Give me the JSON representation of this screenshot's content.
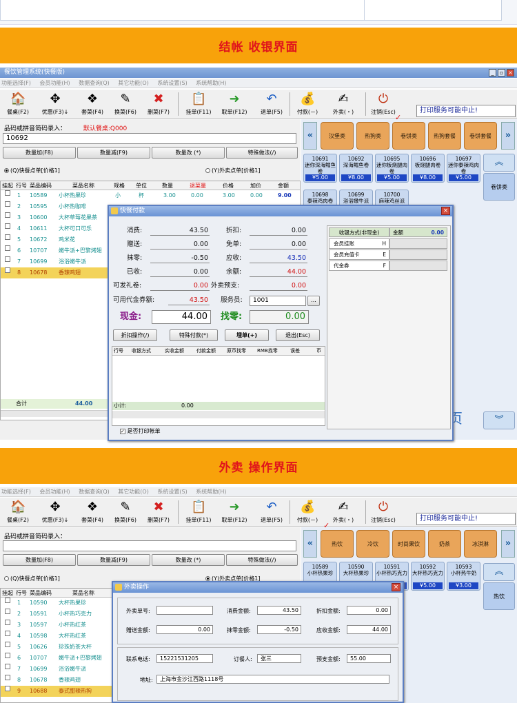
{
  "section1": {
    "banner": "结帐 收银界面"
  },
  "section2": {
    "banner": "外卖 操作界面"
  },
  "app": {
    "title": "餐饮管理系统(快餐版)"
  },
  "menu": [
    "功能选择(F)",
    "会员功能(H)",
    "数据查询(Q)",
    "其它功能(O)",
    "系统设置(S)",
    "系统帮助(H)"
  ],
  "menu2": [
    "功能选择(F)",
    "会员功能(H)",
    "数据查询(Q)",
    "其它功能(O)",
    "系统设置(S)",
    "系统帮助(H)"
  ],
  "toolbar": {
    "b1": "餐桌(F2)",
    "b2": "优惠(F3)↓",
    "b3": "套菜(F4)",
    "b4": "换菜(F6)",
    "b5": "删菜(F7)",
    "b6": "挂单(F11)",
    "b7": "取单(F12)",
    "b8": "退单(F5)",
    "b9": "付款(－)",
    "b10": "外卖(・)",
    "b11": "注销(Esc)",
    "notice": "打印服务可能中止!"
  },
  "entry": {
    "label": "品码或拼音简码录入：",
    "table_label": "默认餐桌:Q000",
    "value1": "10692",
    "value2": ""
  },
  "qty_buttons": {
    "inc": "数量加(F8)",
    "dec": "数量减(F9)",
    "change": "数量改 (*)",
    "special": "特殊做法(/)"
  },
  "order_mode": {
    "fast": "(Q)快餐点单[价格1]",
    "takeout": "(Y)外卖点单[价格1]"
  },
  "grid1": {
    "headers": [
      "挂起",
      "行号",
      "菜品编码",
      "菜品名称",
      "规格",
      "单位",
      "数量",
      "退菜量",
      "价格",
      "加价",
      "金额"
    ],
    "rows": [
      {
        "no": "1",
        "code": "10589",
        "name": "小杯热果珍",
        "spec": "小",
        "unit": "杯",
        "qty": "3.00",
        "ret": "0.00",
        "price": "3.00",
        "add": "0.00",
        "amt": "9.00"
      },
      {
        "no": "2",
        "code": "10595",
        "name": "小杯热咖啡"
      },
      {
        "no": "3",
        "code": "10600",
        "name": "大杯草莓花果茶"
      },
      {
        "no": "4",
        "code": "10611",
        "name": "大杯可口可乐"
      },
      {
        "no": "5",
        "code": "10672",
        "name": "鸡米花"
      },
      {
        "no": "6",
        "code": "10707",
        "name": "嫩牛派+巴黎烤翅"
      },
      {
        "no": "7",
        "code": "10699",
        "name": "浴浴嫩牛派"
      },
      {
        "no": "8",
        "code": "10678",
        "name": "香辣鸡翅"
      }
    ],
    "total_label": "合计",
    "total": "44.00"
  },
  "cats1": [
    "汉堡类",
    "热狗类",
    "卷饼类",
    "热狗套餐",
    "卷饼套餐"
  ],
  "tiles1": [
    {
      "code": "10691",
      "name": "迷你深海鳕鱼卷",
      "price": "¥5.00"
    },
    {
      "code": "10692",
      "name": "深海鳕鱼卷",
      "price": "¥8.00"
    },
    {
      "code": "10695",
      "name": "迷你板烧腿肉卷",
      "price": "¥5.00"
    },
    {
      "code": "10696",
      "name": "板烧腿肉卷",
      "price": "¥8.00"
    },
    {
      "code": "10697",
      "name": "迷你泰辣鸡肉卷",
      "price": "¥5.00"
    },
    {
      "code": "10698",
      "name": "泰辣鸡肉卷",
      "price": ""
    },
    {
      "code": "10699",
      "name": "浴浴嫩牛派",
      "price": ""
    },
    {
      "code": "10700",
      "name": "麻辣鸡丝派",
      "price": ""
    }
  ],
  "side1": "卷饼类",
  "side_hint": "页",
  "pay": {
    "title": "快餐付款",
    "consume_l": "消费:",
    "consume": "43.50",
    "discount_l": "折扣:",
    "discount": "0.00",
    "gift_l": "赠送:",
    "gift": "0.00",
    "free_l": "免单:",
    "free": "0.00",
    "round_l": "抹零:",
    "round": "-0.50",
    "due_l": "应收:",
    "due": "43.50",
    "paid_l": "已收:",
    "paid": "0.00",
    "balance_l": "余额:",
    "balance": "44.00",
    "gift_coupon_l": "可发礼卷:",
    "gift_coupon": "0.00",
    "takeout_fee_l": "外卖预支:",
    "takeout_fee": "0.00",
    "voucher_l": "可用代金券额:",
    "voucher": "43.50",
    "waiter_l": "服务员:",
    "waiter": "1001",
    "cash_l": "现金:",
    "cash": "44.00",
    "change_l": "找零:",
    "change": "0.00",
    "b1": "折扣操作(/)",
    "b2": "特殊付款(*)",
    "b3": "埋单(+)",
    "b4": "退出(Esc)",
    "cols": [
      "行号",
      "收银方式",
      "实收金额",
      "付款金额",
      "原币找零",
      "RMB找零",
      "误差",
      "币"
    ],
    "subtotal_l": "小计:",
    "subtotal": "0.00",
    "print_label": "是否打印帐单",
    "methods_head": "收银方式(非现金)",
    "methods_amt": "金额",
    "methods_total": "0.00",
    "methods": [
      {
        "name": "会员挂账",
        "key": "H"
      },
      {
        "name": "会员充值卡",
        "key": "E"
      },
      {
        "name": "代金券",
        "key": "F"
      }
    ]
  },
  "grid2": {
    "headers": [
      "挂起",
      "行号",
      "菜品编码",
      "菜品名称"
    ],
    "rows": [
      {
        "no": "1",
        "code": "10590",
        "name": "大杯热果珍"
      },
      {
        "no": "2",
        "code": "10591",
        "name": "小杯热巧克力"
      },
      {
        "no": "3",
        "code": "10597",
        "name": "小杯热红茶"
      },
      {
        "no": "4",
        "code": "10598",
        "name": "大杯热红茶"
      },
      {
        "no": "5",
        "code": "10626",
        "name": "珍珠奶茶大杯"
      },
      {
        "no": "6",
        "code": "10707",
        "name": "嫩牛派+巴黎烤翅"
      },
      {
        "no": "7",
        "code": "10699",
        "name": "浴浴嫩牛派"
      },
      {
        "no": "8",
        "code": "10678",
        "name": "香辣鸡翅"
      },
      {
        "no": "9",
        "code": "10688",
        "name": "泰式甜辣热狗"
      }
    ]
  },
  "cats2": [
    "热饮",
    "冷饮",
    "时尚果饮",
    "奶茶",
    "冰淇淋"
  ],
  "tiles2": [
    {
      "code": "10589",
      "name": "小杯热果珍",
      "price": "¥5.00"
    },
    {
      "code": "10590",
      "name": "大杯热果珍",
      "price": "¥8.00"
    },
    {
      "code": "10591",
      "name": "小杯热巧克力",
      "price": "¥5.00"
    },
    {
      "code": "10592",
      "name": "大杯热巧克力",
      "price": "¥5.00"
    },
    {
      "code": "10593",
      "name": "小杯热牛奶",
      "price": "¥3.00"
    },
    {
      "code": "10597",
      "name": "小杯热红茶",
      "price": "¥4.00"
    },
    {
      "code": "10598",
      "name": "大杯热红茶",
      "price": "¥5.00"
    }
  ],
  "side2": "热饮",
  "takeout": {
    "title": "外卖操作",
    "order_no_l": "外卖单号:",
    "order_no": "",
    "consume_l": "消费金额:",
    "consume": "43.50",
    "discount_l": "折扣金额:",
    "discount": "0.00",
    "gift_l": "赠送金额:",
    "gift": "0.00",
    "round_l": "抹零金额:",
    "round": "-0.50",
    "due_l": "应收金额:",
    "due": "44.00",
    "phone_l": "联系电话:",
    "phone": "15221531205",
    "person_l": "订餐人:",
    "person": "张三",
    "prepay_l": "预支金额:",
    "prepay": "55.00",
    "addr_l": "地址:",
    "addr": "上海市金沙江西路1118号"
  },
  "colors": {
    "banner": "#f8a20a",
    "banner_text": "#e0141c",
    "title": "#6e95d2",
    "selected_row": "#f3d35a",
    "price": "#1e47c4"
  }
}
